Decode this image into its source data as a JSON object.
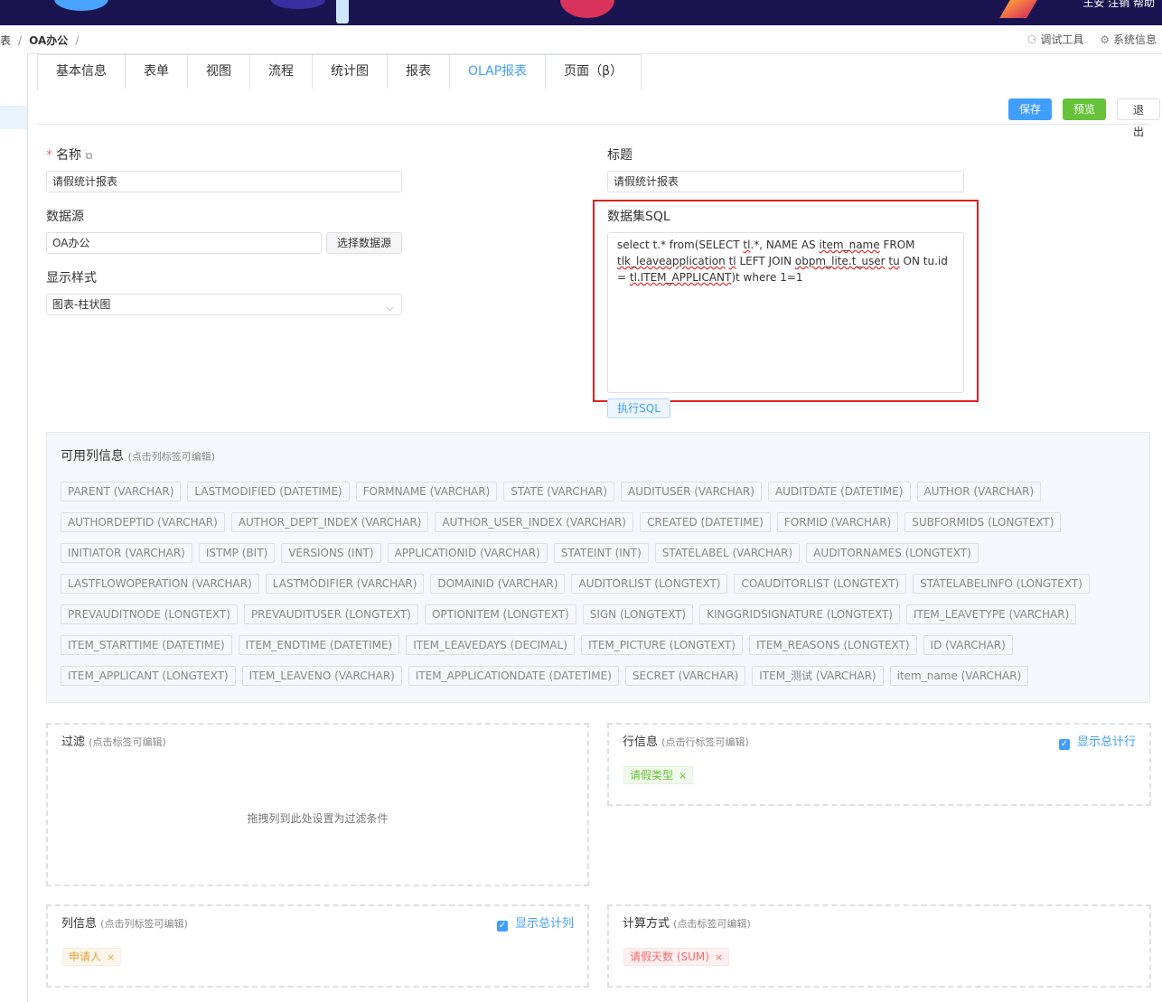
{
  "header": {
    "user_text": "王安 注销 帮助"
  },
  "breadcrumb": {
    "left": "表",
    "current": "OA办公"
  },
  "tools": {
    "debug": "调试工具",
    "sysinfo": "系统信息"
  },
  "tabs": [
    "基本信息",
    "表单",
    "视图",
    "流程",
    "统计图",
    "报表",
    "OLAP报表",
    "页面（β）"
  ],
  "active_tab": "OLAP报表",
  "actions": {
    "save": "保存",
    "preview": "预览",
    "exit": "退出"
  },
  "form": {
    "name_label": "名称",
    "name_value": "请假统计报表",
    "title_label": "标题",
    "title_value": "请假统计报表",
    "datasource_label": "数据源",
    "datasource_value": "OA办公",
    "select_datasource": "选择数据源",
    "display_label": "显示样式",
    "display_value": "图表-柱状图",
    "sql_label": "数据集SQL",
    "sql_parts": {
      "p1": "select t.* from(SELECT ",
      "w1": "tl",
      "p2": ".*, NAME AS ",
      "w2": "item_name",
      "p3": " FROM ",
      "w3": "tlk_leaveapplication",
      "p4": " ",
      "w4": "tl",
      "p5": " LEFT JOIN ",
      "w5": "obpm_lite.t_user",
      "p6": " ",
      "w6": "tu",
      "p7": " ON tu.id = ",
      "w7": "tl.ITEM_APPLICANT",
      "p8": ")t where 1=1"
    },
    "exec_sql": "执行SQL"
  },
  "columns_panel": {
    "title": "可用列信息",
    "hint": "(点击列标签可编辑)",
    "rows": [
      [
        "PARENT (VARCHAR)",
        "LASTMODIFIED (DATETIME)",
        "FORMNAME (VARCHAR)",
        "STATE (VARCHAR)",
        "AUDITUSER (VARCHAR)",
        "AUDITDATE (DATETIME)",
        "AUTHOR (VARCHAR)"
      ],
      [
        "AUTHORDEPTID (VARCHAR)",
        "AUTHOR_DEPT_INDEX (VARCHAR)",
        "AUTHOR_USER_INDEX (VARCHAR)",
        "CREATED (DATETIME)",
        "FORMID (VARCHAR)",
        "SUBFORMIDS (LONGTEXT)"
      ],
      [
        "INITIATOR (VARCHAR)",
        "ISTMP (BIT)",
        "VERSIONS (INT)",
        "APPLICATIONID (VARCHAR)",
        "STATEINT (INT)",
        "STATELABEL (VARCHAR)",
        "AUDITORNAMES (LONGTEXT)"
      ],
      [
        "LASTFLOWOPERATION (VARCHAR)",
        "LASTMODIFIER (VARCHAR)",
        "DOMAINID (VARCHAR)",
        "AUDITORLIST (LONGTEXT)",
        "COAUDITORLIST (LONGTEXT)",
        "STATELABELINFO (LONGTEXT)"
      ],
      [
        "PREVAUDITNODE (LONGTEXT)",
        "PREVAUDITUSER (LONGTEXT)",
        "OPTIONITEM (LONGTEXT)",
        "SIGN (LONGTEXT)",
        "KINGGRIDSIGNATURE (LONGTEXT)",
        "ITEM_LEAVETYPE (VARCHAR)"
      ],
      [
        "ITEM_STARTTIME (DATETIME)",
        "ITEM_ENDTIME (DATETIME)",
        "ITEM_LEAVEDAYS (DECIMAL)",
        "ITEM_PICTURE (LONGTEXT)",
        "ITEM_REASONS (LONGTEXT)",
        "ID (VARCHAR)"
      ],
      [
        "ITEM_APPLICANT (LONGTEXT)",
        "ITEM_LEAVENO (VARCHAR)",
        "ITEM_APPLICATIONDATE (DATETIME)",
        "SECRET (VARCHAR)",
        "ITEM_测试 (VARCHAR)",
        "item_name (VARCHAR)"
      ]
    ]
  },
  "filter": {
    "title": "过滤",
    "hint": "(点击标签可编辑)",
    "empty": "拖拽列到此处设置为过滤条件"
  },
  "row_info": {
    "title": "行信息",
    "hint": "(点击行标签可编辑)",
    "checkbox": "显示总计行",
    "tag": "请假类型"
  },
  "col_info": {
    "title": "列信息",
    "hint": "(点击列标签可编辑)",
    "checkbox": "显示总计列",
    "tag": "申请人"
  },
  "calc": {
    "title": "计算方式",
    "hint": "(点击标签可编辑)",
    "tag": "请假天数 (SUM)"
  }
}
